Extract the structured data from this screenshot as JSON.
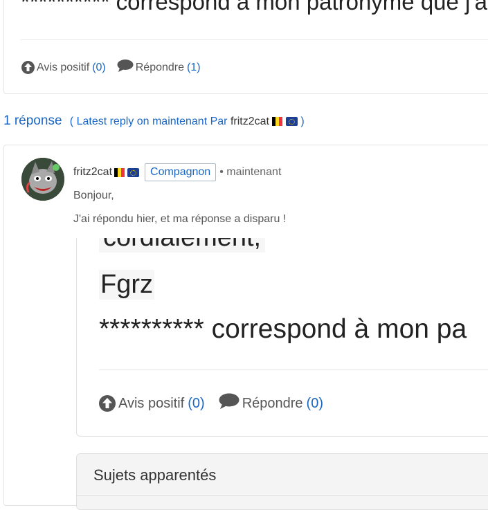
{
  "top_post": {
    "stars_text": "********** correspond à mon patronyme que j'a",
    "upvote_label": "Avis positif",
    "upvote_count": "(0)",
    "reply_label": "Répondre",
    "reply_count": "(1)"
  },
  "replies_header": {
    "count_label": "1 réponse",
    "meta_prefix": "( Latest reply on maintenant Par",
    "author": "fritz2cat",
    "meta_suffix": ")"
  },
  "reply": {
    "author": "fritz2cat",
    "badge": "Compagnon",
    "time": "• maintenant",
    "line1": "Bonjour,",
    "line2": "J'ai répondu hier, et ma réponse a disparu !"
  },
  "screenshot": {
    "line1": "cordialement,",
    "line2": "Fgrz",
    "line3": "********** correspond à mon pa",
    "upvote_label": "Avis positif",
    "upvote_count": "(0)",
    "reply_label": "Répondre",
    "reply_count": "(0)"
  },
  "related": {
    "title": "Sujets apparentés"
  },
  "colors": {
    "link": "#1a66c4",
    "border": "#e3e3e3"
  },
  "icons": {
    "upvote": "arrow-up-circle-icon",
    "reply": "speech-bubble-icon",
    "flag_be": "belgium-flag-icon",
    "flag_eu": "eu-flag-icon"
  }
}
